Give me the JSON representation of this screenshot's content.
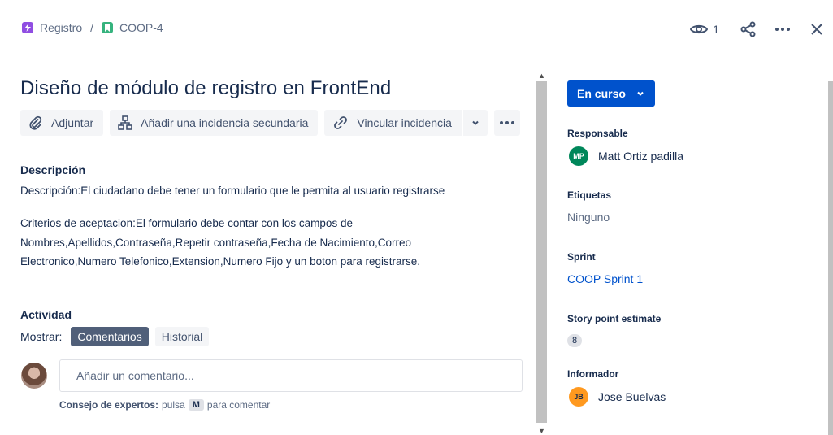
{
  "breadcrumb": {
    "project": "Registro",
    "separator": "/",
    "issue_key": "COOP-4"
  },
  "header": {
    "watch_count": "1"
  },
  "issue": {
    "title": "Diseño de módulo de registro en FrontEnd"
  },
  "toolbar": {
    "attach": "Adjuntar",
    "add_child": "Añadir una incidencia secundaria",
    "link_issue": "Vincular incidencia"
  },
  "description": {
    "heading": "Descripción",
    "line1": "Descripción:El ciudadano debe tener un formulario que le permita al usuario registrarse",
    "line2": "Criterios de aceptacion:El formulario debe contar con los campos de",
    "line3": "Nombres,Apellidos,Contraseña,Repetir contraseña,Fecha de Nacimiento,Correo",
    "line4": "Electronico,Numero Telefonico,Extension,Numero Fijo y un boton para registrarse."
  },
  "activity": {
    "heading": "Actividad",
    "show_label": "Mostrar:",
    "tab_comments": "Comentarios",
    "tab_history": "Historial",
    "comment_placeholder": "Añadir un comentario...",
    "tip_bold": "Consejo de expertos:",
    "tip_press": "pulsa",
    "tip_key": "M",
    "tip_rest": "para comentar"
  },
  "sidebar": {
    "status": "En curso",
    "assignee_label": "Responsable",
    "assignee_initials": "MP",
    "assignee_name": "Matt Ortiz padilla",
    "labels_label": "Etiquetas",
    "labels_value": "Ninguno",
    "sprint_label": "Sprint",
    "sprint_value": "COOP Sprint 1",
    "estimate_label": "Story point estimate",
    "estimate_value": "8",
    "reporter_label": "Informador",
    "reporter_initials": "JB",
    "reporter_name": "Jose Buelvas"
  },
  "colors": {
    "primary": "#0052cc",
    "text": "#172b4d",
    "muted": "#5e6c84",
    "chip_active": "#505f79",
    "epic": "#904ee2",
    "story": "#36b37e"
  }
}
